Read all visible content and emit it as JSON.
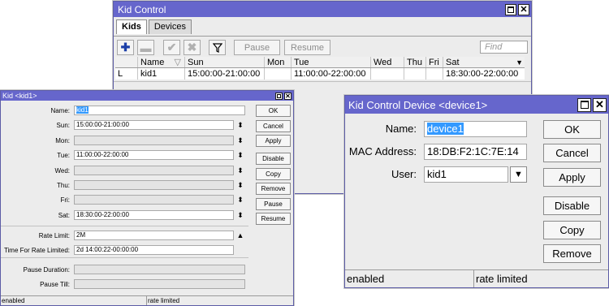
{
  "main": {
    "title": "Kid Control",
    "tabs": [
      "Kids",
      "Devices"
    ],
    "toolbar": {
      "add_icon": "plus-icon",
      "remove_icon": "minus-icon",
      "enable_icon": "check-icon",
      "disable_icon": "x-icon",
      "filter_icon": "funnel-icon",
      "pause_label": "Pause",
      "resume_label": "Resume",
      "find_placeholder": "Find"
    },
    "columns": [
      "",
      "Name",
      "Sun",
      "Mon",
      "Tue",
      "Wed",
      "Thu",
      "Fri",
      "Sat"
    ],
    "rows": [
      {
        "flag": "L",
        "name": "kid1",
        "sun": "15:00:00-21:00:00",
        "mon": "",
        "tue": "11:00:00-22:00:00",
        "wed": "",
        "thu": "",
        "fri": "",
        "sat": "18:30:00-22:00:00"
      }
    ]
  },
  "kid": {
    "title": "Kid <kid1>",
    "fields": {
      "name": {
        "label": "Name:",
        "value": "kid1"
      },
      "sun": {
        "label": "Sun:",
        "value": "15:00:00-21:00:00"
      },
      "mon": {
        "label": "Mon:",
        "value": ""
      },
      "tue": {
        "label": "Tue:",
        "value": "11:00:00-22:00:00"
      },
      "wed": {
        "label": "Wed:",
        "value": ""
      },
      "thu": {
        "label": "Thu:",
        "value": ""
      },
      "fri": {
        "label": "Fri:",
        "value": ""
      },
      "sat": {
        "label": "Sat:",
        "value": "18:30:00-22:00:00"
      },
      "rate_limit": {
        "label": "Rate Limit:",
        "value": "2M"
      },
      "time_for_rate_limited": {
        "label": "Time For Rate Limited:",
        "value": "2d 14:00:22-00:00:00"
      },
      "pause_duration": {
        "label": "Pause Duration:",
        "value": ""
      },
      "pause_till": {
        "label": "Pause Till:",
        "value": ""
      }
    },
    "buttons": {
      "ok": "OK",
      "cancel": "Cancel",
      "apply": "Apply",
      "disable": "Disable",
      "copy": "Copy",
      "remove": "Remove",
      "pause": "Pause",
      "resume": "Resume"
    },
    "status": {
      "left": "enabled",
      "right": "rate limited"
    }
  },
  "device": {
    "title": "Kid Control Device <device1>",
    "fields": {
      "name": {
        "label": "Name:",
        "value": "device1"
      },
      "mac": {
        "label": "MAC Address:",
        "value": "18:DB:F2:1C:7E:14"
      },
      "user": {
        "label": "User:",
        "value": "kid1"
      }
    },
    "buttons": {
      "ok": "OK",
      "cancel": "Cancel",
      "apply": "Apply",
      "disable": "Disable",
      "copy": "Copy",
      "remove": "Remove"
    },
    "status": {
      "left": "enabled",
      "right": "rate limited"
    }
  },
  "colors": {
    "titlebar": "#6666cc",
    "selection": "#3399ff",
    "window_bg": "#ececec"
  }
}
